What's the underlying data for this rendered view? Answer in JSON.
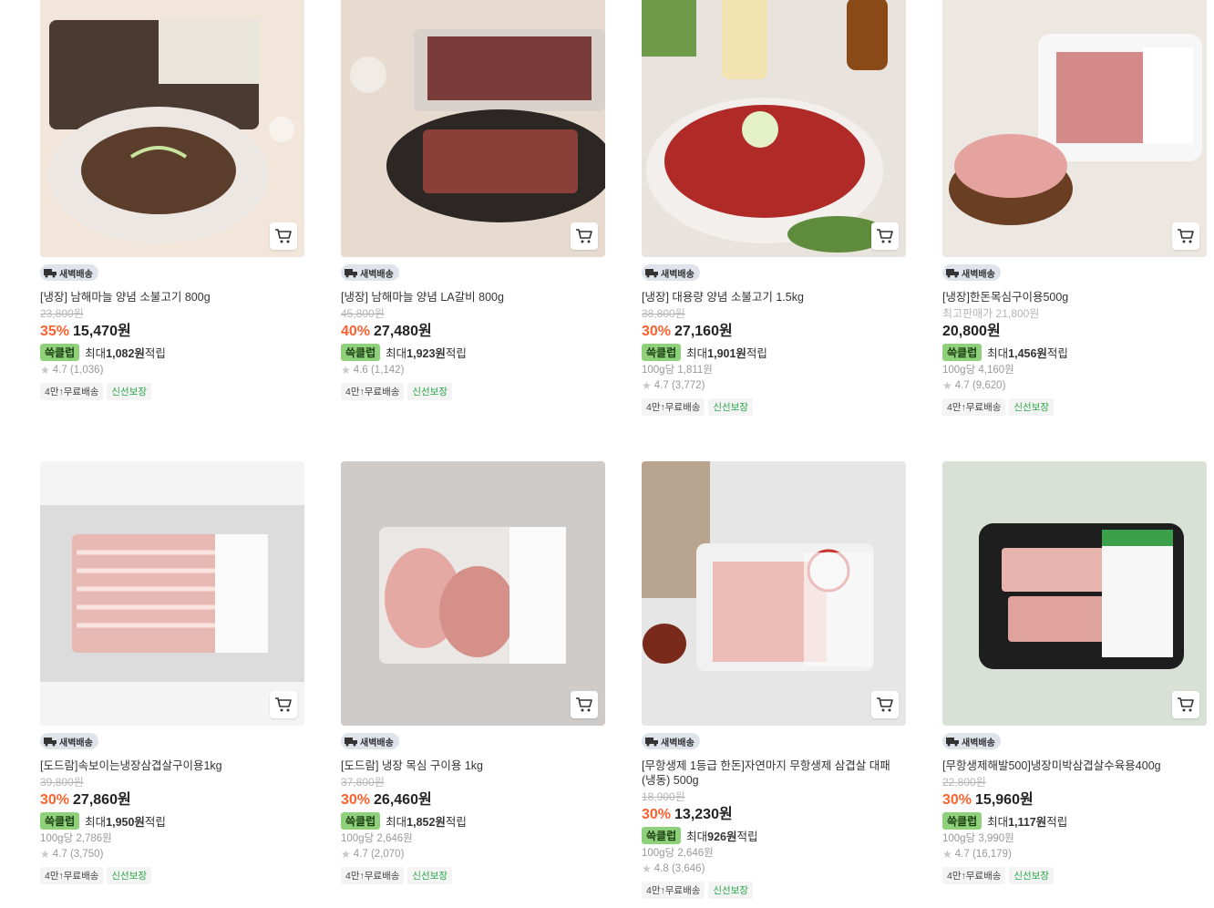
{
  "colors": {
    "discount": "#fa622f",
    "reward_tag": "#8fd07a",
    "fresh_chip": "#2aa74b"
  },
  "products": [
    {
      "badge": "새벽배송",
      "name": "[냉장] 남해마늘 양념 소불고기 800g",
      "original_price": "23,800원",
      "discount": "35%",
      "price": "15,470원",
      "reward_tag": "쓱클럽",
      "reward_prefix": "최대",
      "reward_amount": "1,082원",
      "reward_suffix": " 적립",
      "unit_price": "",
      "rating": "4.7",
      "reviews": "(1,036)",
      "chips": [
        "4만↑무료배송",
        "신선보장"
      ],
      "cart_icon": "cart-icon"
    },
    {
      "badge": "새벽배송",
      "name": "[냉장] 남해마늘 양념 LA갈비 800g",
      "original_price": "45,800원",
      "discount": "40%",
      "price": "27,480원",
      "reward_tag": "쓱클럽",
      "reward_prefix": "최대",
      "reward_amount": "1,923원",
      "reward_suffix": " 적립",
      "unit_price": "",
      "rating": "4.6",
      "reviews": "(1,142)",
      "chips": [
        "4만↑무료배송",
        "신선보장"
      ],
      "cart_icon": "cart-icon"
    },
    {
      "badge": "새벽배송",
      "name": "[냉장] 대용량 양념 소불고기 1.5kg",
      "original_price": "38,800원",
      "discount": "30%",
      "price": "27,160원",
      "reward_tag": "쓱클럽",
      "reward_prefix": "최대",
      "reward_amount": "1,901원",
      "reward_suffix": " 적립",
      "unit_price": "100g당 1,811원",
      "rating": "4.7",
      "reviews": "(3,772)",
      "chips": [
        "4만↑무료배송",
        "신선보장"
      ],
      "cart_icon": "cart-icon"
    },
    {
      "badge": "새벽배송",
      "name": "[냉장]한돈목심구이용500g",
      "original_price": "최고판매가 21,800원",
      "discount": "",
      "price": "20,800원",
      "reward_tag": "쓱클럽",
      "reward_prefix": "최대",
      "reward_amount": "1,456원",
      "reward_suffix": " 적립",
      "unit_price": "100g당 4,160원",
      "rating": "4.7",
      "reviews": "(9,620)",
      "chips": [
        "4만↑무료배송",
        "신선보장"
      ],
      "cart_icon": "cart-icon"
    },
    {
      "badge": "새벽배송",
      "name": "[도드람]속보이는냉장삼겹살구이용1kg",
      "original_price": "39,800원",
      "discount": "30%",
      "price": "27,860원",
      "reward_tag": "쓱클럽",
      "reward_prefix": "최대",
      "reward_amount": "1,950원",
      "reward_suffix": " 적립",
      "unit_price": "100g당 2,786원",
      "rating": "4.7",
      "reviews": "(3,750)",
      "chips": [
        "4만↑무료배송",
        "신선보장"
      ],
      "cart_icon": "cart-icon"
    },
    {
      "badge": "새벽배송",
      "name": "[도드람] 냉장 목심 구이용 1kg",
      "original_price": "37,800원",
      "discount": "30%",
      "price": "26,460원",
      "reward_tag": "쓱클럽",
      "reward_prefix": "최대",
      "reward_amount": "1,852원",
      "reward_suffix": " 적립",
      "unit_price": "100g당 2,646원",
      "rating": "4.7",
      "reviews": "(2,070)",
      "chips": [
        "4만↑무료배송",
        "신선보장"
      ],
      "cart_icon": "cart-icon"
    },
    {
      "badge": "새벽배송",
      "name": "[무항생제 1등급 한돈]자연마지 무항생제 삼겹살 대패 (냉동) 500g",
      "original_price": "18,900원",
      "discount": "30%",
      "price": "13,230원",
      "reward_tag": "쓱클럽",
      "reward_prefix": "최대",
      "reward_amount": "926원",
      "reward_suffix": " 적립",
      "unit_price": "100g당 2,646원",
      "rating": "4.8",
      "reviews": "(3,646)",
      "chips": [
        "4만↑무료배송",
        "신선보장"
      ],
      "cart_icon": "cart-icon"
    },
    {
      "badge": "새벽배송",
      "name": "[무항생제해발500]냉장미박삼겹살수육용400g",
      "original_price": "22,800원",
      "discount": "30%",
      "price": "15,960원",
      "reward_tag": "쓱클럽",
      "reward_prefix": "최대",
      "reward_amount": "1,117원",
      "reward_suffix": " 적립",
      "unit_price": "100g당 3,990원",
      "rating": "4.7",
      "reviews": "(16,179)",
      "chips": [
        "4만↑무료배송",
        "신선보장"
      ],
      "cart_icon": "cart-icon"
    }
  ]
}
